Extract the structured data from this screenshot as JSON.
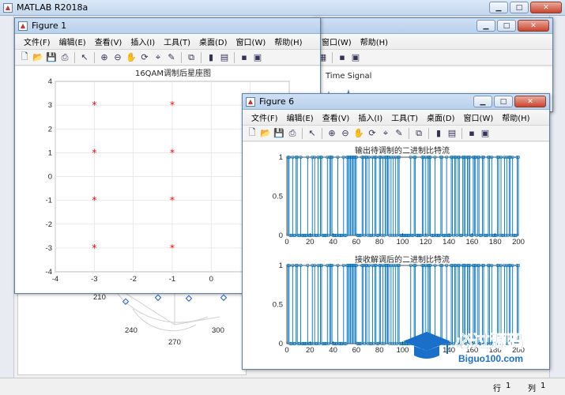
{
  "main_window": {
    "title": "MATLAB R2018a",
    "status": {
      "row_label": "行",
      "row_value": "1",
      "col_label": "列",
      "col_value": "1"
    }
  },
  "bg_polar": {
    "angle_labels": [
      "210",
      "240",
      "270",
      "300"
    ]
  },
  "bg_figure": {
    "menu_items": [
      "窗口(W)",
      "帮助(H)"
    ],
    "plot_title_fragment": "Time Signal"
  },
  "figure1": {
    "title": "Figure 1",
    "menu_items": [
      "文件(F)",
      "编辑(E)",
      "查看(V)",
      "插入(I)",
      "工具(T)",
      "桌面(D)",
      "窗口(W)",
      "帮助(H)"
    ],
    "chart_data": {
      "type": "scatter",
      "title": "16QAM调制后星座图",
      "marker": "*",
      "marker_color": "#ff0000",
      "x": [
        -3,
        -3,
        -3,
        -3,
        -1,
        -1,
        -1,
        -1,
        1,
        1,
        1,
        1
      ],
      "y": [
        3,
        1,
        -1,
        -3,
        3,
        1,
        -1,
        -3,
        3,
        1,
        -1,
        -3
      ],
      "xlim": [
        -4,
        2
      ],
      "ylim": [
        -4,
        4
      ],
      "xticks": [
        "-4",
        "-3",
        "-2",
        "-1",
        "0",
        "1",
        "2"
      ],
      "yticks": [
        "4",
        "3",
        "2",
        "1",
        "0",
        "-1",
        "-2",
        "-3",
        "-4"
      ],
      "grid": true
    }
  },
  "figure6": {
    "title": "Figure 6",
    "menu_items": [
      "文件(F)",
      "编辑(E)",
      "查看(V)",
      "插入(I)",
      "工具(T)",
      "桌面(D)",
      "窗口(W)",
      "帮助(H)"
    ],
    "chart_data": [
      {
        "type": "stem",
        "title": "输出待调制的二进制比特流",
        "xlim": [
          0,
          200
        ],
        "ylim": [
          0,
          1
        ],
        "xticks": [
          "0",
          "20",
          "40",
          "60",
          "80",
          "100",
          "120",
          "140",
          "160",
          "180",
          "200"
        ],
        "yticks": [
          "1",
          "0.5",
          "0"
        ],
        "color": "#0072bd"
      },
      {
        "type": "stem",
        "title": "接收解调后的二进制比特流",
        "xlim": [
          0,
          200
        ],
        "ylim": [
          0,
          1
        ],
        "xticks": [
          "0",
          "20",
          "40",
          "60",
          "80",
          "100",
          "120",
          "140",
          "160",
          "180",
          "200"
        ],
        "yticks": [
          "1",
          "0.5",
          "0"
        ],
        "color": "#0072bd"
      }
    ]
  },
  "watermark": {
    "cn": "必过源码",
    "en": "Biguo100.com"
  }
}
